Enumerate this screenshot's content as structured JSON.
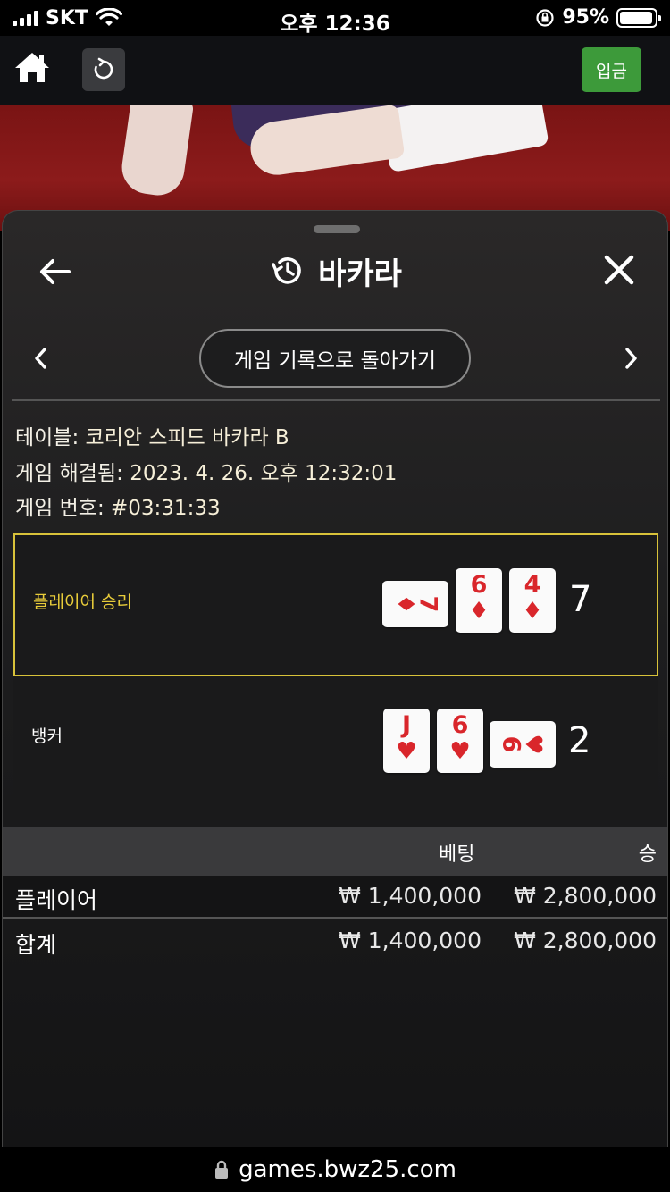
{
  "status_bar": {
    "carrier": "SKT",
    "time": "오후 12:36",
    "battery": "95%",
    "battery_level": 0.95
  },
  "nav": {
    "deposit_label": "입금"
  },
  "panel": {
    "title": "바카라",
    "back_history_label": "게임 기록으로 돌아가기",
    "info": [
      {
        "label": "테이블:",
        "value": "코리안 스피드 바카라 B"
      },
      {
        "label": "게임 해결됨:",
        "value": "2023. 4. 26. 오후 12:32:01"
      },
      {
        "label": "게임 번호:",
        "value": "#03:31:33"
      }
    ],
    "player": {
      "label": "플레이어 승리",
      "score": "7",
      "cards": [
        {
          "rank": "7",
          "suit": "♦",
          "orientation": "sideways"
        },
        {
          "rank": "6",
          "suit": "♦",
          "orientation": "upright"
        },
        {
          "rank": "4",
          "suit": "♦",
          "orientation": "upright"
        }
      ]
    },
    "banker": {
      "label": "뱅커",
      "score": "2",
      "cards": [
        {
          "rank": "J",
          "suit": "♥",
          "orientation": "upright"
        },
        {
          "rank": "6",
          "suit": "♥",
          "orientation": "upright"
        },
        {
          "rank": "6",
          "suit": "♥",
          "orientation": "sideways"
        }
      ]
    },
    "bets": {
      "headers": {
        "bet": "베팅",
        "win": "승"
      },
      "rows": [
        {
          "name": "플레이어",
          "bet": "₩ 1,400,000",
          "win": "₩ 2,800,000"
        },
        {
          "name": "합계",
          "bet": "₩ 1,400,000",
          "win": "₩ 2,800,000"
        }
      ]
    }
  },
  "url_bar": {
    "url": "games.bwz25.com"
  },
  "colors": {
    "accent_green": "#3d9a3a",
    "winner_highlight": "#d8c23a",
    "card_red": "#d9262b"
  }
}
